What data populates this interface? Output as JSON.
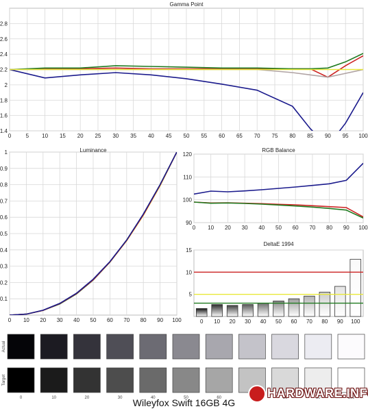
{
  "footer": {
    "device_name": "Wileyfox Swift 16GB 4G",
    "logo_text": "HARDWARE.INFO"
  },
  "colors": {
    "red": "#cc2222",
    "green": "#1f7a1f",
    "blue": "#1a1a8c",
    "gray": "#b0a3a3",
    "yellow": "#e8e83a",
    "grid": "#d8d8d8"
  },
  "chart_data": [
    {
      "id": "gamma",
      "type": "line",
      "title": "Gamma Point",
      "x": [
        0,
        10,
        20,
        30,
        40,
        50,
        60,
        70,
        80,
        85,
        90,
        95,
        100
      ],
      "xticks": [
        0,
        5,
        10,
        15,
        20,
        25,
        30,
        35,
        40,
        45,
        50,
        55,
        60,
        65,
        70,
        75,
        80,
        85,
        90,
        95,
        100
      ],
      "yticks": [
        1.4,
        1.6,
        1.8,
        2,
        2.2,
        2.4,
        2.6,
        2.8
      ],
      "xlim": [
        0,
        100
      ],
      "ylim": [
        1.4,
        3.0
      ],
      "series": [
        {
          "color": "#cc2222",
          "values": [
            2.2,
            2.21,
            2.21,
            2.22,
            2.21,
            2.21,
            2.21,
            2.21,
            2.21,
            2.21,
            2.1,
            2.25,
            2.38
          ]
        },
        {
          "color": "#1f7a1f",
          "values": [
            2.2,
            2.22,
            2.22,
            2.25,
            2.24,
            2.23,
            2.22,
            2.22,
            2.21,
            2.21,
            2.22,
            2.3,
            2.41
          ]
        },
        {
          "color": "#b0a3a3",
          "values": [
            2.2,
            2.2,
            2.2,
            2.2,
            2.2,
            2.2,
            2.2,
            2.2,
            2.16,
            2.13,
            2.1,
            2.15,
            2.2
          ]
        },
        {
          "color": "#1a1a8c",
          "values": [
            2.2,
            2.09,
            2.13,
            2.16,
            2.13,
            2.08,
            2.01,
            1.93,
            1.72,
            1.43,
            1.2,
            1.5,
            1.9
          ]
        },
        {
          "color": "#e8e83a",
          "values": [
            2.2,
            2.2,
            2.2,
            2.2,
            2.2,
            2.2,
            2.2,
            2.2,
            2.2,
            2.2,
            2.2,
            2.2,
            2.2
          ]
        }
      ]
    },
    {
      "id": "luminance",
      "type": "line",
      "title": "Luminance",
      "x": [
        0,
        10,
        20,
        30,
        40,
        50,
        60,
        70,
        80,
        90,
        100
      ],
      "xticks": [
        0,
        10,
        20,
        30,
        40,
        50,
        60,
        70,
        80,
        90,
        100
      ],
      "yticks": [
        0.1,
        0.2,
        0.3,
        0.4,
        0.5,
        0.6,
        0.7,
        0.8,
        0.9,
        1
      ],
      "xlim": [
        0,
        100
      ],
      "ylim": [
        0,
        1
      ],
      "series": [
        {
          "color": "#e8e83a",
          "values": [
            0,
            0.006,
            0.029,
            0.071,
            0.133,
            0.218,
            0.325,
            0.456,
            0.612,
            0.793,
            1
          ]
        },
        {
          "color": "#1f7a1f",
          "values": [
            0,
            0.006,
            0.029,
            0.068,
            0.13,
            0.215,
            0.325,
            0.46,
            0.618,
            0.8,
            1
          ]
        },
        {
          "color": "#cc2222",
          "values": [
            0,
            0.006,
            0.029,
            0.07,
            0.132,
            0.217,
            0.326,
            0.458,
            0.615,
            0.797,
            1
          ]
        },
        {
          "color": "#1a1a8c",
          "values": [
            0,
            0.006,
            0.03,
            0.072,
            0.134,
            0.22,
            0.328,
            0.46,
            0.62,
            0.8,
            1
          ]
        }
      ]
    },
    {
      "id": "rgb",
      "type": "line",
      "title": "RGB Balance",
      "x": [
        0,
        10,
        20,
        30,
        40,
        50,
        60,
        70,
        80,
        90,
        100
      ],
      "xticks": [
        0,
        10,
        20,
        30,
        40,
        50,
        60,
        70,
        80,
        90,
        100
      ],
      "yticks": [
        90,
        100,
        110,
        120
      ],
      "xlim": [
        0,
        100
      ],
      "ylim": [
        90,
        120
      ],
      "series": [
        {
          "color": "#1a1a8c",
          "values": [
            102.5,
            103.8,
            103.5,
            103.9,
            104.4,
            105,
            105.6,
            106.3,
            107,
            108.5,
            116
          ]
        },
        {
          "color": "#cc2222",
          "values": [
            99,
            98.6,
            98.7,
            98.5,
            98.3,
            98,
            97.8,
            97.4,
            97,
            96.6,
            92.5
          ]
        },
        {
          "color": "#1f7a1f",
          "values": [
            99,
            98.5,
            98.6,
            98.4,
            98.1,
            97.7,
            97.3,
            96.8,
            96.2,
            95.5,
            92
          ]
        }
      ]
    },
    {
      "id": "deltae",
      "type": "bar",
      "title": "DeltaE 1994",
      "categories": [
        "0",
        "10",
        "20",
        "30",
        "40",
        "50",
        "60",
        "70",
        "80",
        "90",
        "100"
      ],
      "values": [
        1.8,
        2.7,
        2.5,
        2.7,
        3.0,
        3.5,
        4.0,
        4.6,
        5.5,
        6.8,
        12.9
      ],
      "yticks": [
        5,
        10,
        15
      ],
      "ylim": [
        0,
        15
      ],
      "thresholds": [
        {
          "value": 10,
          "color": "#cc2222"
        },
        {
          "value": 5,
          "color": "#e8e83a"
        },
        {
          "value": 3,
          "color": "#1f7a1f"
        }
      ]
    }
  ],
  "swatches": {
    "row_labels": [
      "Actual",
      "Target"
    ],
    "labels": [
      "0",
      "10",
      "20",
      "30",
      "40",
      "50",
      "60",
      "70",
      "80",
      "90",
      "100"
    ],
    "actual": [
      "#050508",
      "#1c1b22",
      "#34333b",
      "#4f4e56",
      "#6c6b73",
      "#8a8990",
      "#a8a7ae",
      "#c4c3ca",
      "#d9d8df",
      "#ececf2",
      "#fcfbfd"
    ],
    "target": [
      "#000000",
      "#1b1b1b",
      "#333333",
      "#4d4d4d",
      "#6a6a6a",
      "#888888",
      "#a6a6a6",
      "#c3c3c3",
      "#d9d9d9",
      "#ededed",
      "#ffffff"
    ]
  }
}
